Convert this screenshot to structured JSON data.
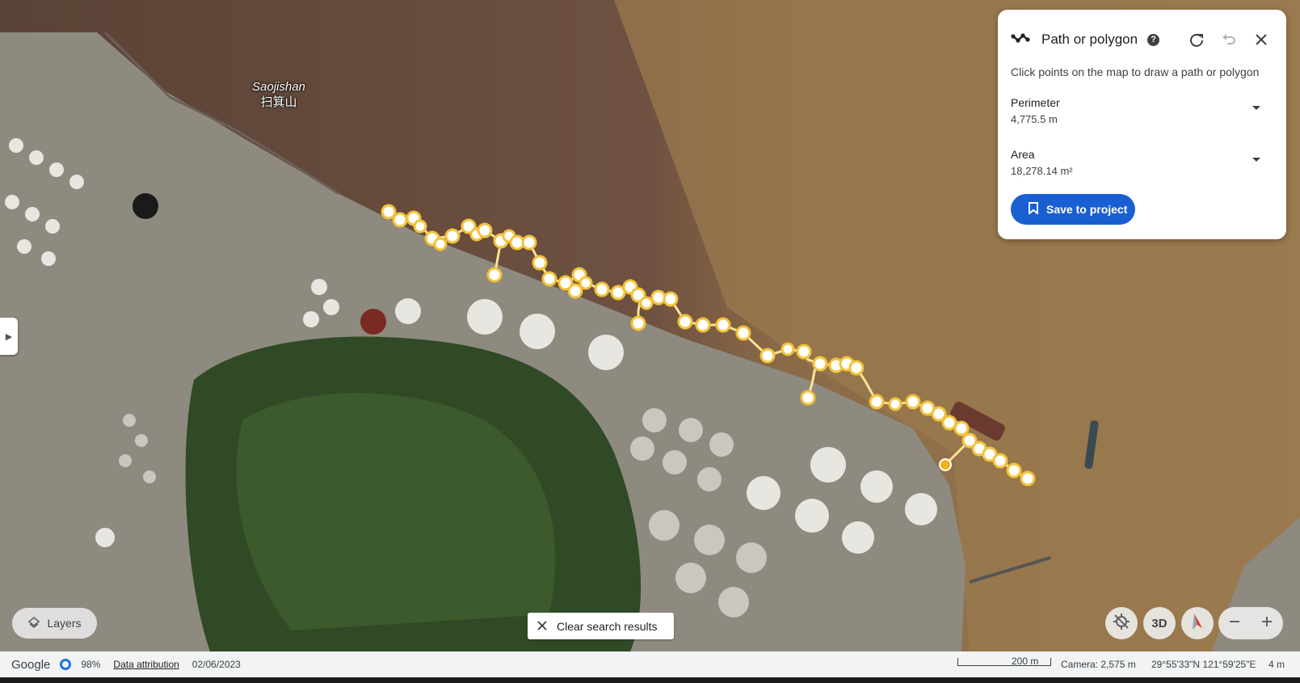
{
  "map": {
    "place_label_latin": "Saojishan",
    "place_label_native": "扫箕山"
  },
  "panel": {
    "title": "Path or polygon",
    "help_glyph": "?",
    "hint": "Click points on the map to draw a path or polygon",
    "perimeter_label": "Perimeter",
    "perimeter_value": "4,775.5 m",
    "area_label": "Area",
    "area_value": "18,278.14 m²",
    "save_label": "Save to project",
    "accent": "#1a5fd1"
  },
  "controls": {
    "layers_label": "Layers",
    "clear_label": "Clear search results",
    "threed_label": "3D"
  },
  "status": {
    "logo": "Google",
    "percent": "98%",
    "attribution": "Data attribution",
    "date": "02/06/2023",
    "scale": "200 m",
    "camera": "Camera: 2,575 m",
    "coords": "29°55'33\"N 121°59'25\"E",
    "elevation": "4 m"
  },
  "icons": [
    "path-icon",
    "help-icon",
    "redo-icon",
    "undo-icon",
    "close-icon",
    "bookmark-icon",
    "layers-icon",
    "clear-icon",
    "recenter-icon",
    "compass-icon",
    "zoom-out-icon",
    "zoom-in-icon",
    "collapse-arrow-icon"
  ]
}
